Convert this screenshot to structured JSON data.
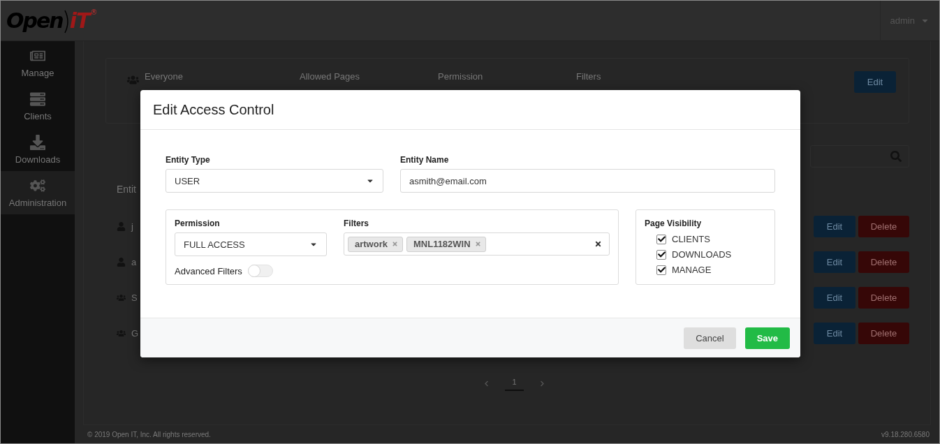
{
  "header": {
    "logo": {
      "word": "Open",
      "mark": "iT",
      "registered": "®"
    },
    "user": "admin"
  },
  "sidebar": {
    "items": [
      {
        "label": "Manage",
        "selected": false
      },
      {
        "label": "Clients",
        "selected": false
      },
      {
        "label": "Downloads",
        "selected": false
      },
      {
        "label": "Administration",
        "selected": true
      }
    ]
  },
  "summary_card": {
    "name": "Everyone",
    "columns": [
      "Allowed Pages",
      "Permission",
      "Filters"
    ],
    "button": "Edit"
  },
  "table": {
    "heading": "Entit",
    "rows": [
      {
        "name": "j",
        "kind": "user",
        "edit": "Edit",
        "delete": "Delete"
      },
      {
        "name": "a",
        "kind": "user",
        "edit": "Edit",
        "delete": "Delete"
      },
      {
        "name": "S",
        "kind": "group",
        "edit": "Edit",
        "delete": "Delete"
      },
      {
        "name": "G",
        "kind": "group",
        "edit": "Edit",
        "delete": "Delete"
      }
    ]
  },
  "pagination": {
    "pages": [
      {
        "label": "1",
        "selected": true
      }
    ]
  },
  "footer": {
    "copyright": "© 2019 Open IT, Inc. All rights reserved.",
    "version": "v9.18.280.6580"
  },
  "dialog": {
    "title": "Edit Access Control",
    "entity_type": {
      "label": "Entity Type",
      "value": "USER"
    },
    "entity_name": {
      "label": "Entity Name",
      "value": "asmith@email.com"
    },
    "permission": {
      "label": "Permission",
      "value": "FULL ACCESS"
    },
    "filters": {
      "label": "Filters",
      "tags": [
        "artwork",
        "MNL1182WIN"
      ]
    },
    "advanced_filters": {
      "label": "Advanced Filters",
      "on": false
    },
    "page_visibility": {
      "title": "Page Visibility",
      "options": [
        {
          "label": "CLIENTS",
          "checked": true
        },
        {
          "label": "DOWNLOADS",
          "checked": true
        },
        {
          "label": "MANAGE",
          "checked": true
        }
      ]
    },
    "buttons": [
      {
        "label": "Cancel",
        "kind": "secondary"
      },
      {
        "label": "Save",
        "kind": "primary"
      }
    ]
  }
}
